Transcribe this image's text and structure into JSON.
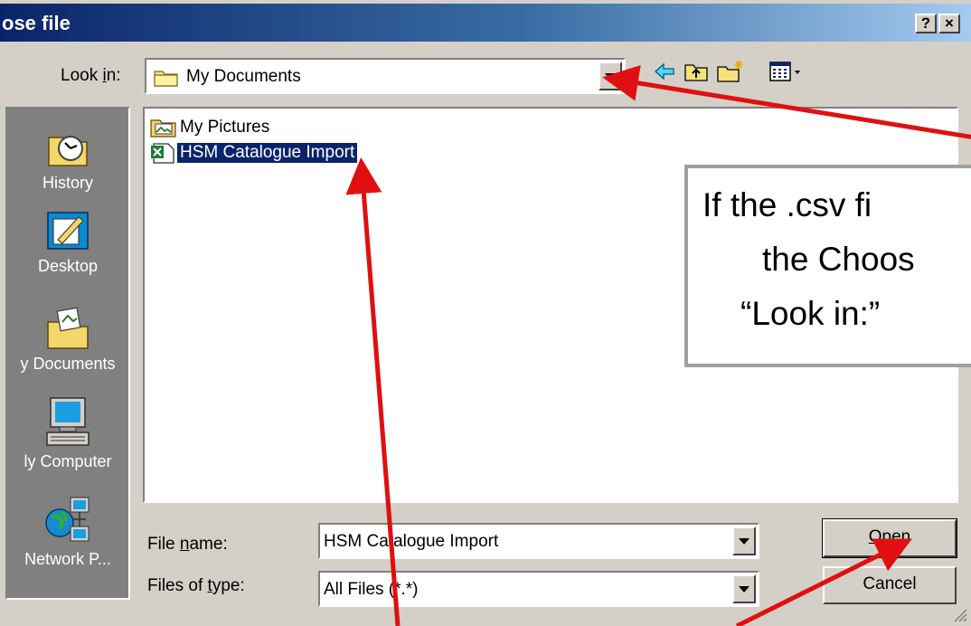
{
  "dialog": {
    "title": "ose file",
    "help_button": "?",
    "close_button": "×"
  },
  "look_in": {
    "label_pre": "Look ",
    "label_key": "i",
    "label_post": "n:",
    "value": "My Documents"
  },
  "toolbar": {
    "icons": [
      "back-arrow-icon",
      "up-folder-icon",
      "new-folder-icon",
      "view-menu-icon"
    ]
  },
  "places": [
    {
      "label": "History",
      "icon": "history-icon"
    },
    {
      "label": "Desktop",
      "icon": "desktop-icon"
    },
    {
      "label": "y Documents",
      "icon": "my-documents-icon"
    },
    {
      "label": "ly Computer",
      "icon": "my-computer-icon"
    },
    {
      "label": "Network P...",
      "icon": "network-places-icon"
    }
  ],
  "files": [
    {
      "name": "My Pictures",
      "icon": "picture-folder-icon",
      "selected": false
    },
    {
      "name": "HSM Catalogue Import",
      "icon": "csv-file-icon",
      "selected": true
    }
  ],
  "file_name": {
    "label_pre": "File ",
    "label_key": "n",
    "label_post": "ame:",
    "value": "HSM Catalogue Import"
  },
  "file_type": {
    "label_pre": "Files of ",
    "label_key": "t",
    "label_post": "ype:",
    "value": "All Files (*.*)"
  },
  "buttons": {
    "open_key": "O",
    "open_rest": "pen",
    "cancel": "Cancel"
  },
  "callout": {
    "line1": "If the .csv fi",
    "line2": "the Choos",
    "line3": "“Look in:”"
  },
  "colors": {
    "title_gradient_start": "#0a246a",
    "title_gradient_end": "#a6caf0",
    "selection": "#0a246a",
    "arrow": "#e01010",
    "dialog_face": "#d4d0c8"
  }
}
